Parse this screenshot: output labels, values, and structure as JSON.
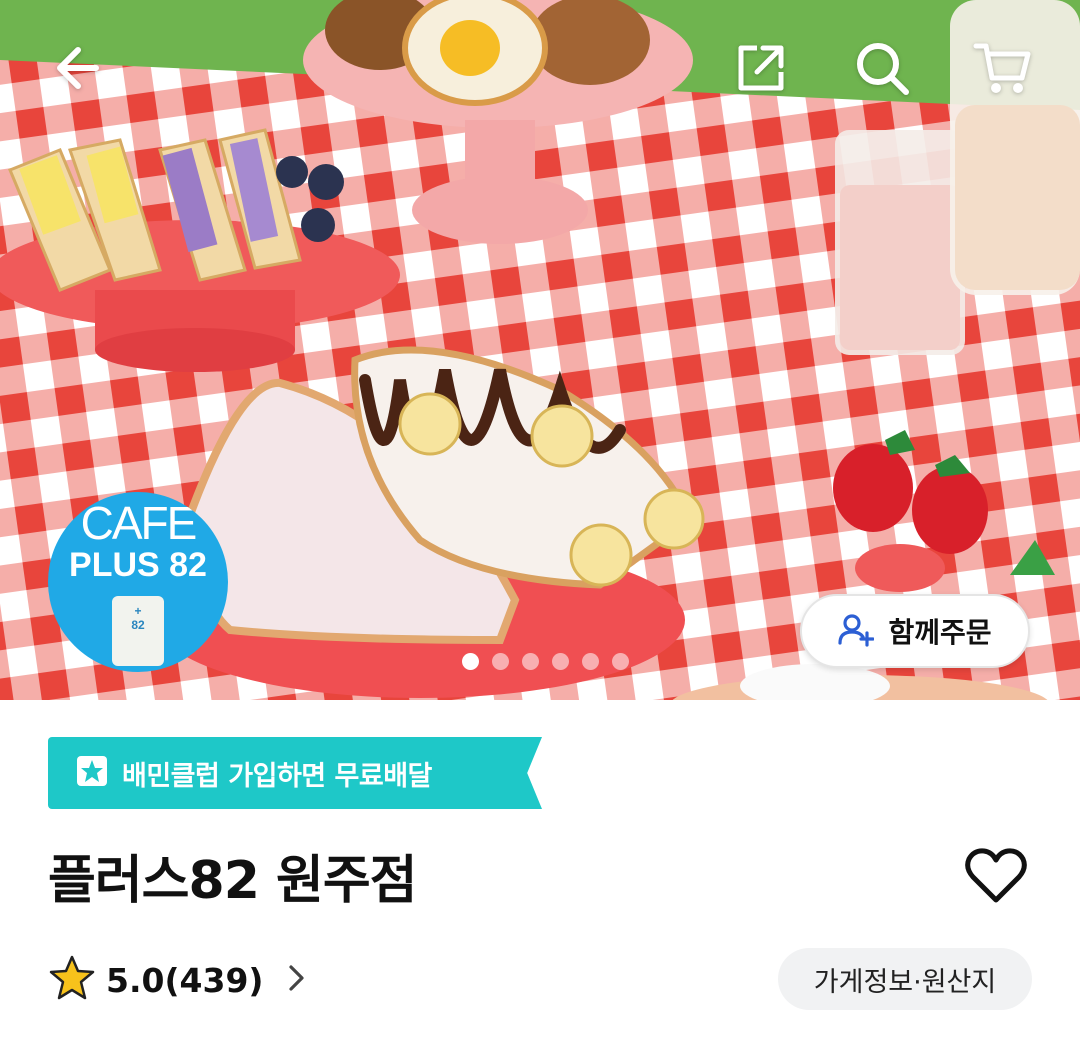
{
  "hero": {
    "logo": {
      "line1": "CAFE",
      "line2": "PLUS 82",
      "can_text": "+\n82"
    },
    "together_order_label": "함께주문",
    "carousel": {
      "total": 6,
      "active_index": 0
    }
  },
  "topbar": {
    "back_icon": "arrow-left-icon",
    "share_icon": "share-icon",
    "search_icon": "search-icon",
    "cart_icon": "cart-icon"
  },
  "promo_banner": {
    "label": "배민클럽 가입하면 무료배달",
    "color": "#1ec8c8"
  },
  "store": {
    "name": "플러스82 원주점",
    "rating": "5.0(439)",
    "info_button_label": "가게정보·원산지"
  },
  "colors": {
    "accent_mint": "#1ec8c8",
    "logo_blue": "#20a9e6",
    "star": "#f7c21b"
  }
}
